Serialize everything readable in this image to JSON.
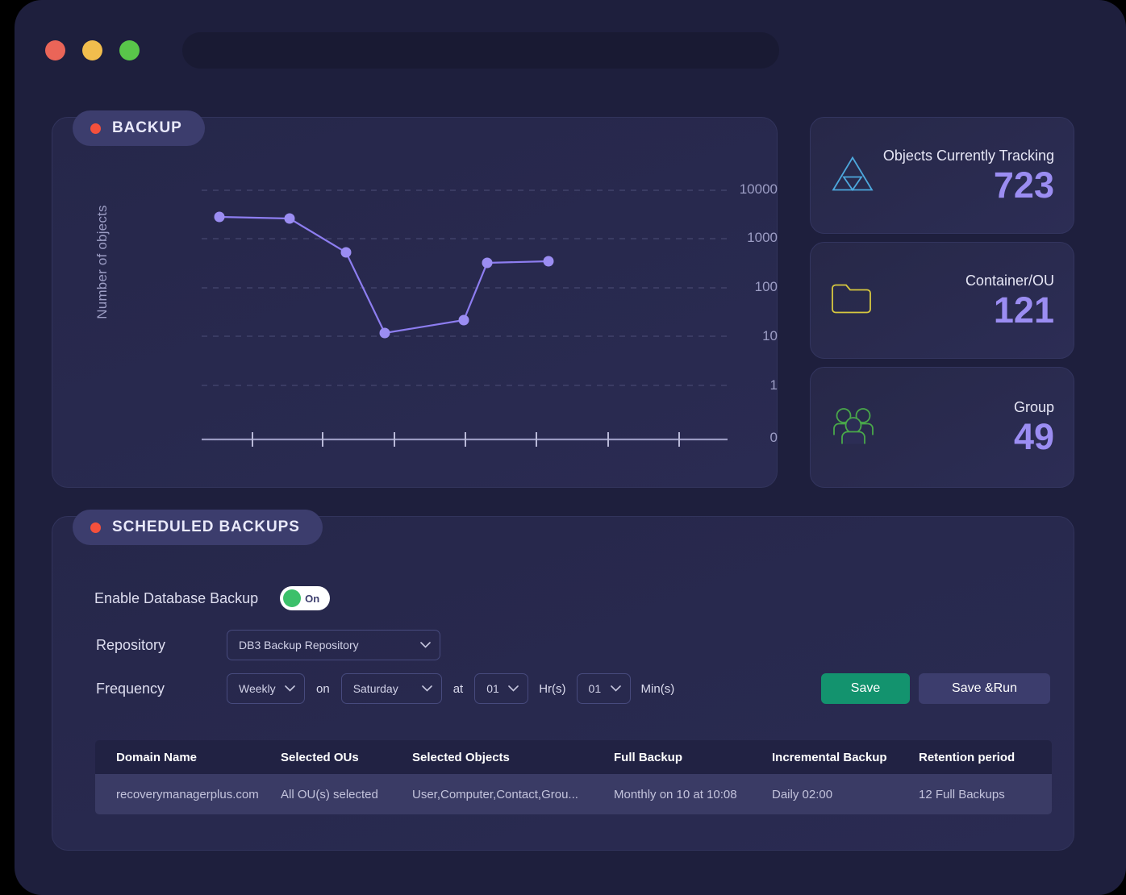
{
  "window": {
    "traffic_lights": [
      "close",
      "minimize",
      "maximize"
    ],
    "url_value": "",
    "url_placeholder": ""
  },
  "backup_section": {
    "chip_label": "BACKUP",
    "dot_color": "#f4503c"
  },
  "chart_data": {
    "type": "line",
    "title": "",
    "xlabel": "",
    "ylabel": "Number of objects",
    "y_scale": "log",
    "y_tick_labels": [
      "10000",
      "1000",
      "100",
      "10",
      "1",
      "0"
    ],
    "y_tick_values": [
      10000,
      1000,
      100,
      10,
      1,
      0
    ],
    "x_tick_labels": [
      "",
      "",
      "",
      "",
      "",
      "",
      ""
    ],
    "x_tick_count": 7,
    "grid": true,
    "legend": "none",
    "line_color": "#8d7df0",
    "marker_color": "#9b8df2",
    "series": [
      {
        "name": "Number of objects",
        "x": [
          1,
          2,
          3,
          4,
          5,
          6,
          7
        ],
        "values": [
          2800,
          2700,
          520,
          12,
          22,
          320,
          340
        ]
      }
    ]
  },
  "stats": [
    {
      "icon": "triangle-icon",
      "icon_color": "#4da8dd",
      "title": "Objects Currently Tracking",
      "value": "723"
    },
    {
      "icon": "folder-icon",
      "icon_color": "#d8c93f",
      "title": "Container/OU",
      "value": "121"
    },
    {
      "icon": "group-icon",
      "icon_color": "#49a84a",
      "title": "Group",
      "value": "49"
    }
  ],
  "scheduled_section": {
    "chip_label": "SCHEDULED BACKUPS",
    "enable_label": "Enable Database Backup",
    "toggle_state": "On",
    "repository_label": "Repository",
    "repository_value": "DB3 Backup Repository",
    "frequency_label": "Frequency",
    "frequency_value": "Weekly",
    "on_label": "on",
    "day_value": "Saturday",
    "at_label": "at",
    "hour_value": "01",
    "hour_unit": "Hr(s)",
    "minute_value": "01",
    "minute_unit": "Min(s)",
    "save_label": "Save",
    "save_run_label": "Save &Run"
  },
  "table": {
    "headers": [
      "Domain Name",
      "Selected OUs",
      "Selected Objects",
      "Full Backup",
      "Incremental Backup",
      "Retention period"
    ],
    "rows": [
      {
        "domain_name": "recoverymanagerplus.com",
        "selected_ous": "All OU(s) selected",
        "selected_objects": "User,Computer,Contact,Grou...",
        "full_backup": "Monthly on 10 at 10:08",
        "incremental_backup": "Daily 02:00",
        "retention_period": "12 Full Backups"
      }
    ]
  }
}
